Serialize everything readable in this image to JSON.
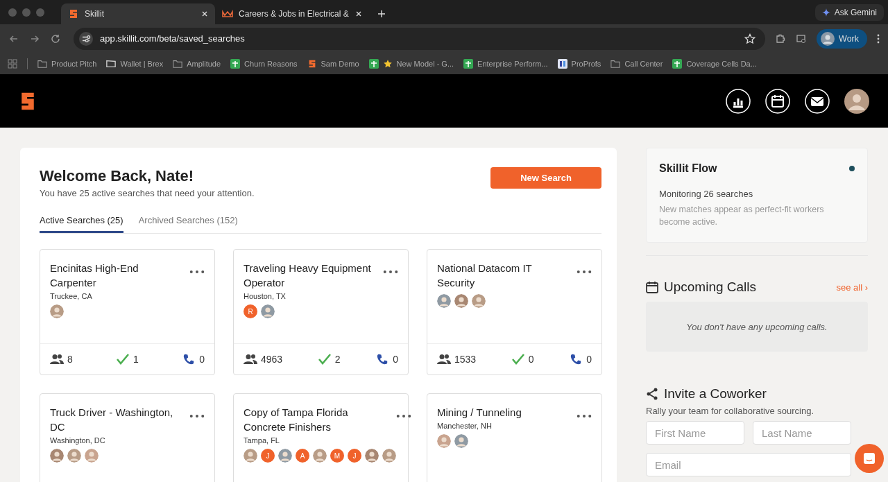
{
  "browser": {
    "tabs": [
      {
        "title": "Skillit",
        "kind": "skillit",
        "selected": true
      },
      {
        "title": "Careers & Jobs in Electrical &",
        "kind": "crown",
        "selected": false
      }
    ],
    "ask_gemini": "Ask Gemini",
    "url": "app.skillit.com/beta/saved_searches",
    "profile": "Work",
    "bookmarks": [
      {
        "label": "Product Pitch",
        "kind": "folder"
      },
      {
        "label": "Wallet | Brex",
        "kind": "wallet"
      },
      {
        "label": "Amplitude",
        "kind": "folder"
      },
      {
        "label": "Churn Reasons",
        "kind": "sheet"
      },
      {
        "label": "Sam Demo",
        "kind": "skillit"
      },
      {
        "label": "New Model - G...",
        "kind": "sheet-star"
      },
      {
        "label": "Enterprise Perform...",
        "kind": "sheet"
      },
      {
        "label": "ProProfs",
        "kind": "pp"
      },
      {
        "label": "Call Center",
        "kind": "folder"
      },
      {
        "label": "Coverage Cells Da...",
        "kind": "sheet"
      }
    ]
  },
  "main": {
    "title": "Welcome Back, Nate!",
    "subtitle": "You have 25 active searches that need your attention.",
    "new_search": "New Search",
    "tabs": [
      {
        "label": "Active Searches (25)",
        "selected": true
      },
      {
        "label": "Archived Searches (152)",
        "selected": false
      }
    ],
    "searches": [
      {
        "title": "Encinitas High-End Carpenter",
        "location": "Truckee, CA",
        "avatars": [
          {
            "kind": "photo"
          }
        ],
        "candidates": "8",
        "matches": "1",
        "calls": "0"
      },
      {
        "title": "Traveling Heavy Equipment Operator",
        "location": "Houston, TX",
        "avatars": [
          {
            "kind": "letter",
            "text": "R"
          },
          {
            "kind": "photo"
          }
        ],
        "candidates": "4963",
        "matches": "2",
        "calls": "0"
      },
      {
        "title": "National Datacom IT Security",
        "avatars": [
          {
            "kind": "photo"
          },
          {
            "kind": "photo"
          },
          {
            "kind": "photo"
          }
        ],
        "candidates": "1533",
        "matches": "0",
        "calls": "0"
      },
      {
        "title": "Truck Driver - Washington, DC",
        "location": "Washington, DC",
        "avatars": [
          {
            "kind": "photo"
          },
          {
            "kind": "photo"
          },
          {
            "kind": "photo"
          }
        ]
      },
      {
        "title": "Copy of Tampa Florida Concrete Finishers",
        "location": "Tampa, FL",
        "avatars": [
          {
            "kind": "photo"
          },
          {
            "kind": "letter",
            "text": "J"
          },
          {
            "kind": "photo"
          },
          {
            "kind": "letter",
            "text": "A"
          },
          {
            "kind": "photo"
          },
          {
            "kind": "letter",
            "text": "M"
          },
          {
            "kind": "letter",
            "text": "J"
          },
          {
            "kind": "photo"
          },
          {
            "kind": "photo"
          }
        ]
      },
      {
        "title": "Mining / Tunneling",
        "location": "Manchester, NH",
        "avatars": [
          {
            "kind": "photo"
          },
          {
            "kind": "photo"
          }
        ]
      }
    ]
  },
  "sidebar": {
    "flow": {
      "title": "Skillit Flow",
      "status": "Monitoring 26 searches",
      "description": "New matches appear as perfect-fit workers become active."
    },
    "calls": {
      "title": "Upcoming Calls",
      "see_all": "see all ›",
      "empty": "You don't have any upcoming calls."
    },
    "invite": {
      "title": "Invite a Coworker",
      "subtitle": "Rally your team for collaborative sourcing.",
      "fields": [
        {
          "placeholder": "First Name"
        },
        {
          "placeholder": "Last Name"
        },
        {
          "placeholder": "Email"
        }
      ]
    }
  }
}
